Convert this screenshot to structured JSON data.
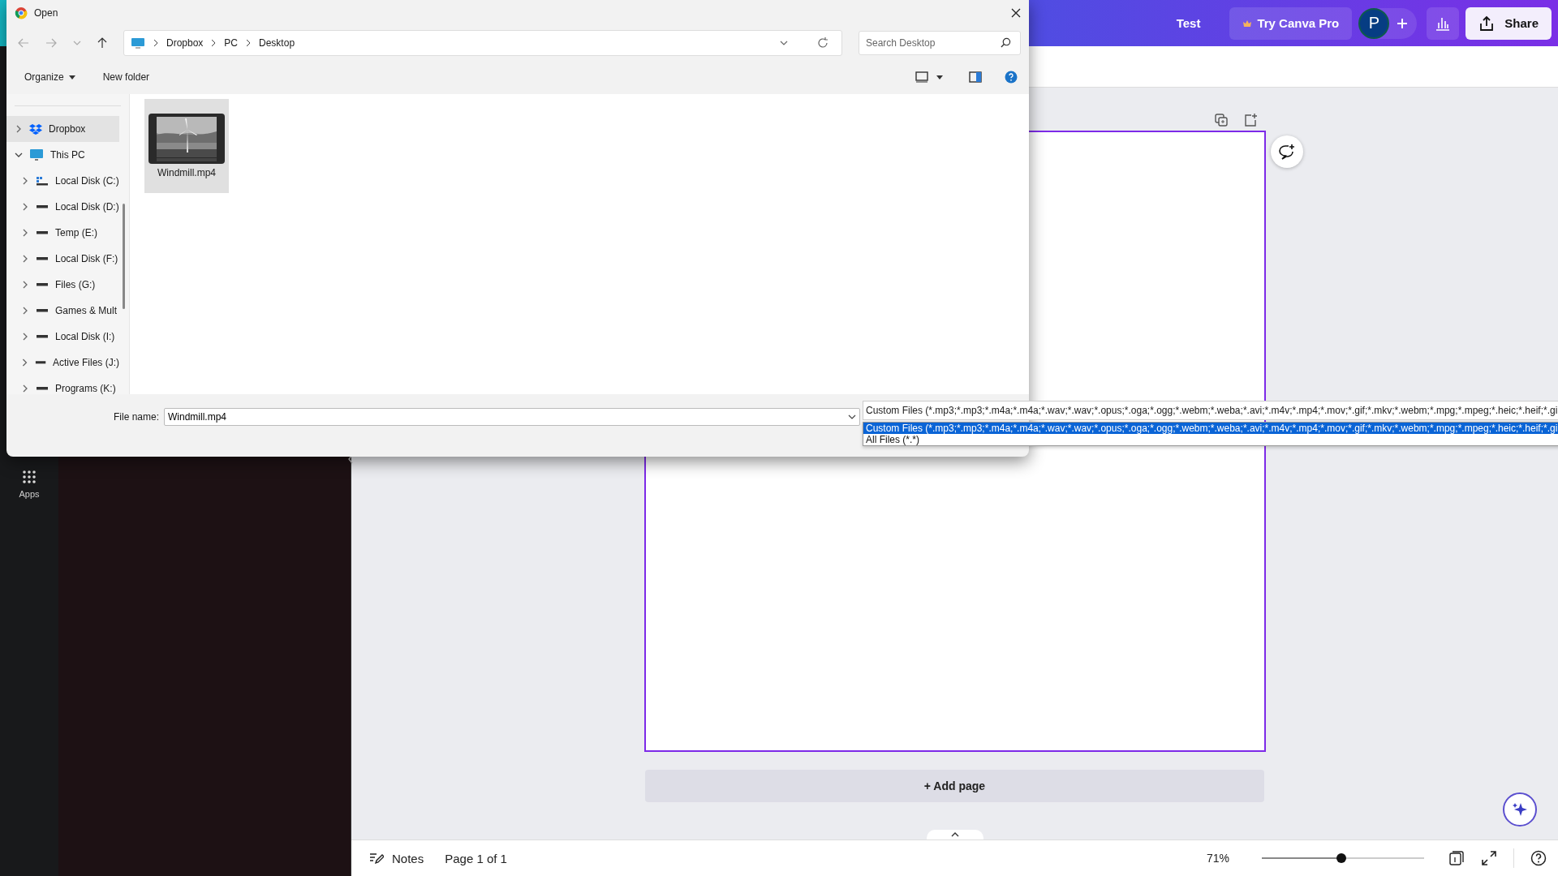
{
  "app": {
    "title": "Test",
    "pro_button": "Try Canva Pro",
    "avatar": "P",
    "share": "Share",
    "rail": [
      {
        "label": "Apps",
        "kind": "apps"
      }
    ]
  },
  "canvas": {
    "add_page": "+ Add page"
  },
  "footer": {
    "notes": "Notes",
    "page": "Page 1 of 1",
    "zoom": "71%",
    "zoom_slider": {
      "level": 0.49
    }
  },
  "dialog": {
    "title": "Open",
    "breadcrumb": [
      "Dropbox",
      "PC",
      "Desktop"
    ],
    "search": {
      "placeholder": "Search Desktop"
    },
    "organize": "Organize",
    "new_folder": "New folder",
    "tree": [
      {
        "label": "Dropbox",
        "kind": "dropbox",
        "selected": true,
        "expanded": false
      },
      {
        "label": "This PC",
        "kind": "pc",
        "selected": false,
        "expanded": true,
        "children": [
          {
            "label": "Local Disk (C:)",
            "kind": "system",
            "selected": false,
            "expanded": false
          },
          {
            "label": "Local Disk (D:)",
            "kind": "drive",
            "selected": false,
            "expanded": false
          },
          {
            "label": "Temp (E:)",
            "kind": "drive",
            "selected": false,
            "expanded": false
          },
          {
            "label": "Local Disk (F:)",
            "kind": "drive",
            "selected": false,
            "expanded": false
          },
          {
            "label": "Files (G:)",
            "kind": "drive",
            "selected": false,
            "expanded": false
          },
          {
            "label": "Games & Mult",
            "kind": "drive",
            "selected": false,
            "expanded": false
          },
          {
            "label": "Local Disk (I:)",
            "kind": "drive",
            "selected": false,
            "expanded": false
          },
          {
            "label": "Active Files (J:)",
            "kind": "drive",
            "selected": false,
            "expanded": false
          },
          {
            "label": "Programs (K:)",
            "kind": "drive",
            "selected": false,
            "expanded": false
          }
        ]
      }
    ],
    "files": [
      {
        "name": "Windmill.mp4",
        "kind": "video",
        "selected": true
      }
    ],
    "file_name": {
      "label": "File name:",
      "value": "Windmill.mp4"
    },
    "file_type": {
      "value": "Custom Files (*.mp3;*.mp3;*.m4a;*.m4a;*.wav;*.wav;*.opus;*.oga;*.ogg;*.webm;*.weba;*.avi;*.m4v;*.mp4;*.mov;*.gif;*.mkv;*.webm;*.mpg;*.mpeg;*.heic;*.heif;*.gi",
      "options": [
        {
          "label": "Custom Files (*.mp3;*.mp3;*.m4a;*.m4a;*.wav;*.wav;*.opus;*.oga;*.ogg;*.webm;*.weba;*.avi;*.m4v;*.mp4;*.mov;*.gif;*.mkv;*.webm;*.mpg;*.mpeg;*.heic;*.heif;*.gi",
          "selected": true
        },
        {
          "label": "All Files (*.*)",
          "selected": false
        }
      ]
    }
  }
}
